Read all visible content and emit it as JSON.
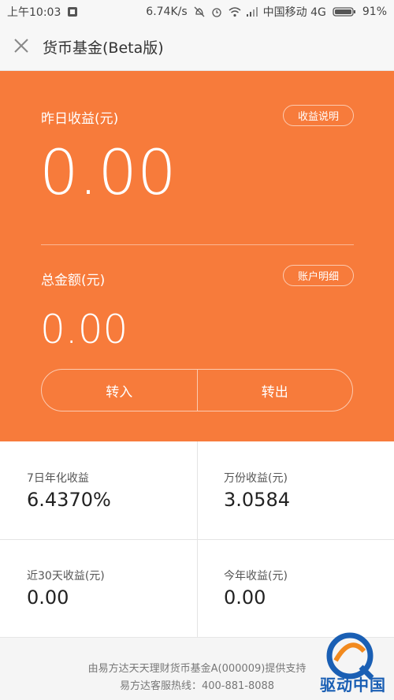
{
  "status_bar": {
    "time": "上午10:03",
    "net_speed": "6.74K/s",
    "carrier": "中国移动 4G",
    "battery": "91%"
  },
  "app_bar": {
    "close_icon": "close-icon",
    "title": "货币基金(Beta版)"
  },
  "hero": {
    "yesterday_label": "昨日收益(元)",
    "yesterday_value": "0.00",
    "earnings_explain_button": "收益说明",
    "total_label": "总金额(元)",
    "total_value": "0.00",
    "account_detail_button": "账户明细",
    "transfer_in": "转入",
    "transfer_out": "转出",
    "color": "#f77b3b"
  },
  "stats": [
    {
      "title": "7日年化收益",
      "value": "6.4370%"
    },
    {
      "title": "万份收益(元)",
      "value": "3.0584"
    },
    {
      "title": "近30天收益(元)",
      "value": "0.00"
    },
    {
      "title": "今年收益(元)",
      "value": "0.00"
    }
  ],
  "footer": {
    "provider": "由易方达天天理财货币基金A(000009)提供支持",
    "hotline": "易方达客服热线：400-881-8088"
  },
  "watermark": {
    "text": "驱动中国"
  }
}
